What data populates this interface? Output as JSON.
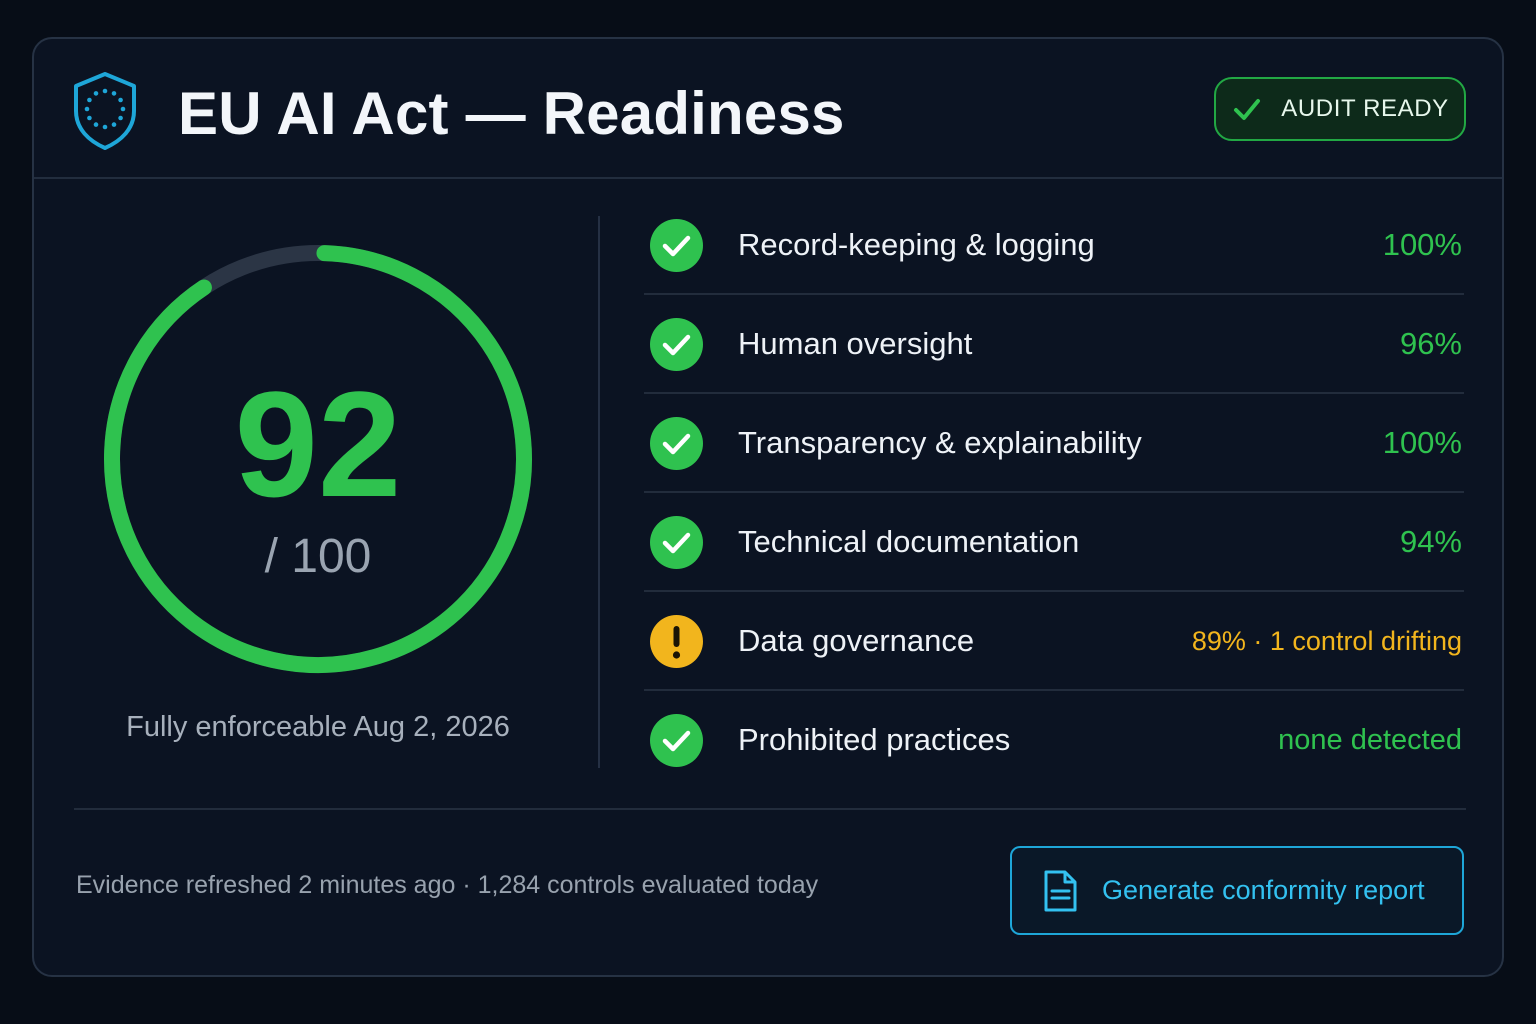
{
  "header": {
    "title": "EU AI Act — Readiness",
    "badge_label": "AUDIT READY",
    "shield_icon": "eu-stars-shield-icon"
  },
  "score": {
    "value": "92",
    "max_label": "/ 100",
    "fraction": 0.92,
    "enforcement_note": "Fully enforceable Aug 2, 2026"
  },
  "checks": [
    {
      "label": "Record-keeping & logging",
      "value": "100%",
      "status": "ok"
    },
    {
      "label": "Human oversight",
      "value": "96%",
      "status": "ok"
    },
    {
      "label": "Transparency & explainability",
      "value": "100%",
      "status": "ok"
    },
    {
      "label": "Technical documentation",
      "value": "94%",
      "status": "ok"
    },
    {
      "label": "Data governance",
      "value": "89% · 1 control drifting",
      "status": "warning"
    },
    {
      "label": "Prohibited practices",
      "value": "none detected",
      "status": "ok"
    }
  ],
  "footer": {
    "note": "Evidence refreshed 2 minutes ago · 1,284 controls evaluated today",
    "report_button_label": "Generate conformity report"
  },
  "colors": {
    "success": "#2fc24f",
    "warning": "#f2b51d",
    "accent": "#1ea6d8",
    "track": "#2b3545"
  }
}
